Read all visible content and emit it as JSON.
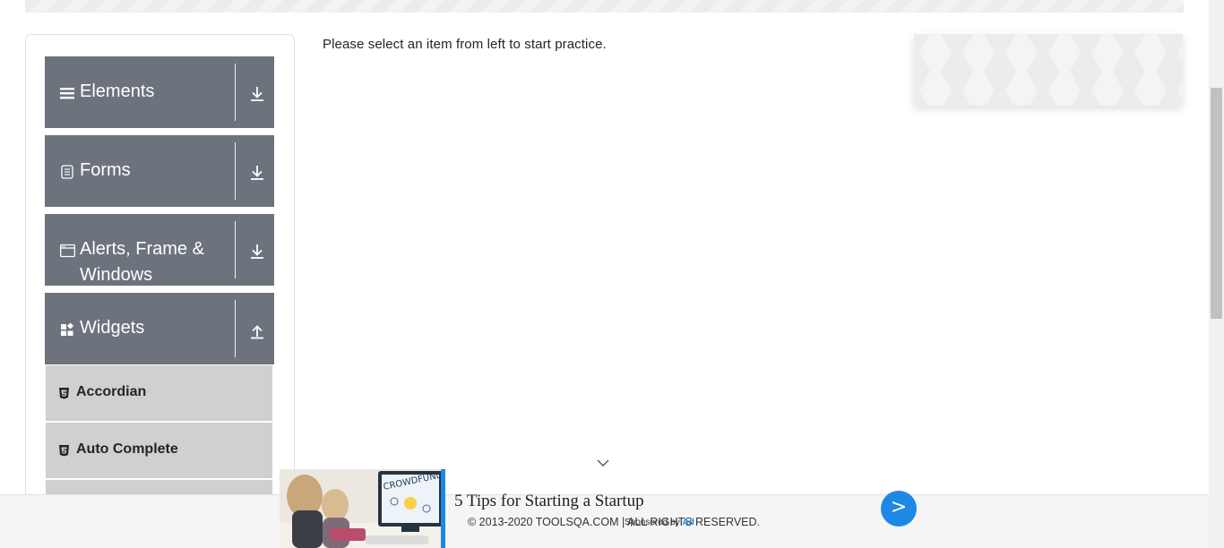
{
  "instruction": "Please select an item from left to start practice.",
  "sidebar": {
    "groups": [
      {
        "label": "Elements",
        "icon": "hamburger-icon",
        "toggle": "expand-icon"
      },
      {
        "label": "Forms",
        "icon": "form-icon",
        "toggle": "expand-icon"
      },
      {
        "label": "Alerts, Frame & Windows",
        "icon": "window-icon",
        "toggle": "expand-icon"
      },
      {
        "label": "Widgets",
        "icon": "widgets-icon",
        "toggle": "collapse-icon"
      }
    ],
    "widgets_items": [
      {
        "label": "Accordian",
        "icon": "html5-icon"
      },
      {
        "label": "Auto Complete",
        "icon": "html5-icon"
      }
    ]
  },
  "footer": {
    "copyright": "© 2013-2020 TOOLSQA.COM | ALL RIGHTS RESERVED."
  },
  "ad": {
    "headline": "5 Tips for Starting a Startup",
    "sponsor_prefix": "Sponsored by",
    "sponsor_brand": "Ad",
    "go_label": ">",
    "image_caption": "CROWDFUNDING"
  },
  "colors": {
    "group_bg": "#6c737c",
    "item_bg": "#d0d0d0",
    "accent": "#1e88e5"
  }
}
